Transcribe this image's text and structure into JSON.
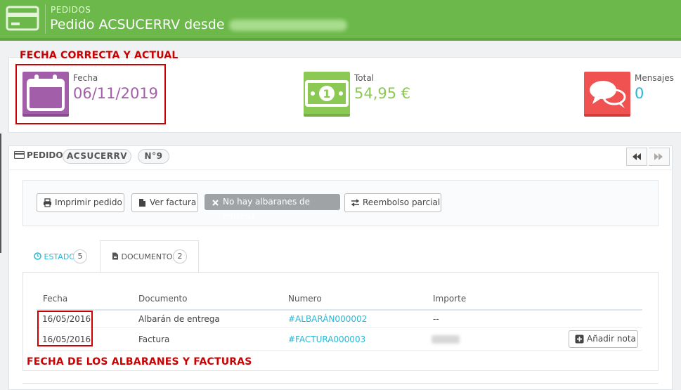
{
  "header": {
    "breadcrumb": "PEDIDOS",
    "title": "Pedido ACSUCERRV desde",
    "icon": "credit-card-icon",
    "bg_color": "#6cb84a"
  },
  "annotations": {
    "top": "FECHA CORRECTA Y ACTUAL",
    "bottom": "FECHA DE LOS ALBARANES Y FACTURAS",
    "color": "#cc0000"
  },
  "kpis": {
    "date": {
      "label": "Fecha",
      "value": "06/11/2019",
      "icon": "calendar-icon",
      "color": "#a25ea8"
    },
    "total": {
      "label": "Total",
      "value": "54,95 €",
      "icon": "money-icon",
      "color": "#8bc954"
    },
    "messages": {
      "label": "Mensajes",
      "value": "0",
      "icon": "chat-bubbles-icon",
      "color": "#f05151"
    }
  },
  "order": {
    "heading": "PEDIDO",
    "reference": "ACSUCERRV",
    "number": "N°9"
  },
  "actions": {
    "print": "Imprimir pedido",
    "invoice": "Ver factura",
    "no_delivery": "No hay albaranes de entrega",
    "refund": "Reembolso parcial"
  },
  "tabs": {
    "status": {
      "label": "ESTADO",
      "count": "5"
    },
    "documents": {
      "label": "DOCUMENTOS",
      "count": "2"
    }
  },
  "documents_table": {
    "headers": [
      "Fecha",
      "Documento",
      "Numero",
      "Importe"
    ],
    "rows": [
      {
        "date": "16/05/2016",
        "document": "Albarán de entrega",
        "number": "#ALBARÁN000002",
        "amount": "--"
      },
      {
        "date": "16/05/2016",
        "document": "Factura",
        "number": "#FACTURA000003",
        "amount": ""
      }
    ],
    "add_note": "Añadir nota"
  }
}
